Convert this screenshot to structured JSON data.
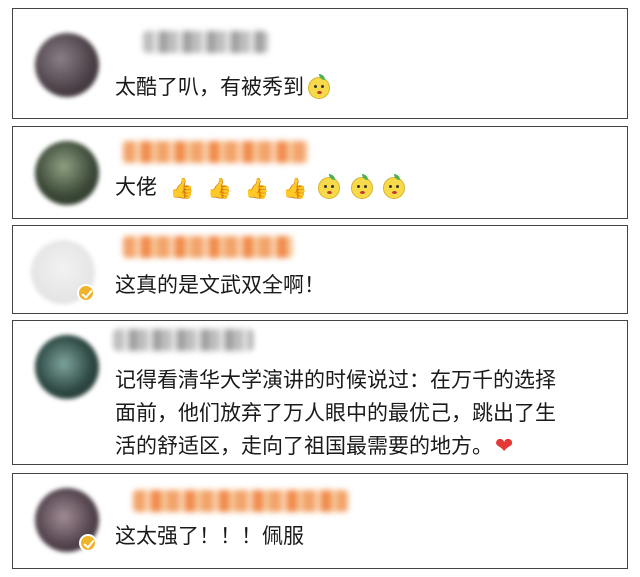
{
  "comments": [
    {
      "text": "太酷了叭，有被秀到",
      "emoji": [
        "lemon-face"
      ]
    },
    {
      "text": "大佬",
      "emoji": [
        "thumbs-up",
        "thumbs-up",
        "thumbs-up",
        "thumbs-up",
        "lemon-face",
        "lemon-face",
        "lemon-face"
      ],
      "thumb_glyph": "👍"
    },
    {
      "text": "这真的是文武双全啊！",
      "verified": true
    },
    {
      "lines": [
        "记得看清华大学演讲的时候说过：在万千的选择",
        "面前，他们放弃了万人眼中的最优己，跳出了生",
        "活的舒适区，走向了祖国最需要的地方。"
      ],
      "heart_glyph": "❤"
    },
    {
      "text": "这太强了！！！佩服",
      "verified": true
    }
  ]
}
